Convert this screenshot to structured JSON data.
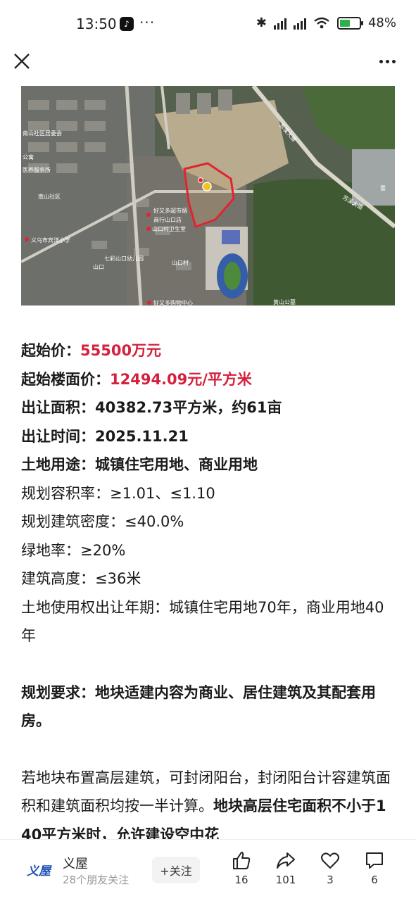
{
  "status": {
    "time": "13:50",
    "app_icon": "tiktok-icon",
    "more": "···",
    "battery": "48%",
    "battery_level": 0.48
  },
  "nav": {
    "close_icon": "close-icon",
    "more_icon": "more-icon"
  },
  "map": {
    "labels": [
      "南山社区居委会",
      "公寓",
      "医养服务所",
      "南山社区",
      "义乌市宾洋小学",
      "好又多超市烟",
      "商行山口店",
      "山口村卫生室",
      "七彩山口幼儿园",
      "山口",
      "山口村",
      "好又多购物中心",
      "黄山公墓",
      "苏溪大道",
      "苏溪大道",
      "雷"
    ]
  },
  "article": {
    "price_label": "起始价：",
    "price_value": "55500万元",
    "floor_price_label": "起始楼面价：",
    "floor_price_value": "12494.09元/平方米",
    "area": "出让面积：40382.73平方米，约61亩",
    "time": "出让时间：2025.11.21",
    "usage": "土地用途：城镇住宅用地、商业用地",
    "far": "规划容积率：≥1.01、≤1.10",
    "density": "规划建筑密度：≤40.0%",
    "green": "绿地率：≥20%",
    "height": "建筑高度：≤36米",
    "term": "土地使用权出让年期：城镇住宅用地70年，商业用地40年",
    "planning": "规划要求：地块适建内容为商业、居住建筑及其配套用房。",
    "para_normal": "若地块布置高层建筑，可封闭阳台，封闭阳台计容建筑面积和建筑面积均按一半计算。",
    "para_bold": "地块高层住宅面积不小于140平方米时，允许建设空中花"
  },
  "bottom": {
    "author_logo": "义屋",
    "author_name": "义屋",
    "author_sub": "28个朋友关注",
    "follow_label": "+关注",
    "likes": "16",
    "shares": "101",
    "favorites": "3",
    "comments": "6"
  }
}
